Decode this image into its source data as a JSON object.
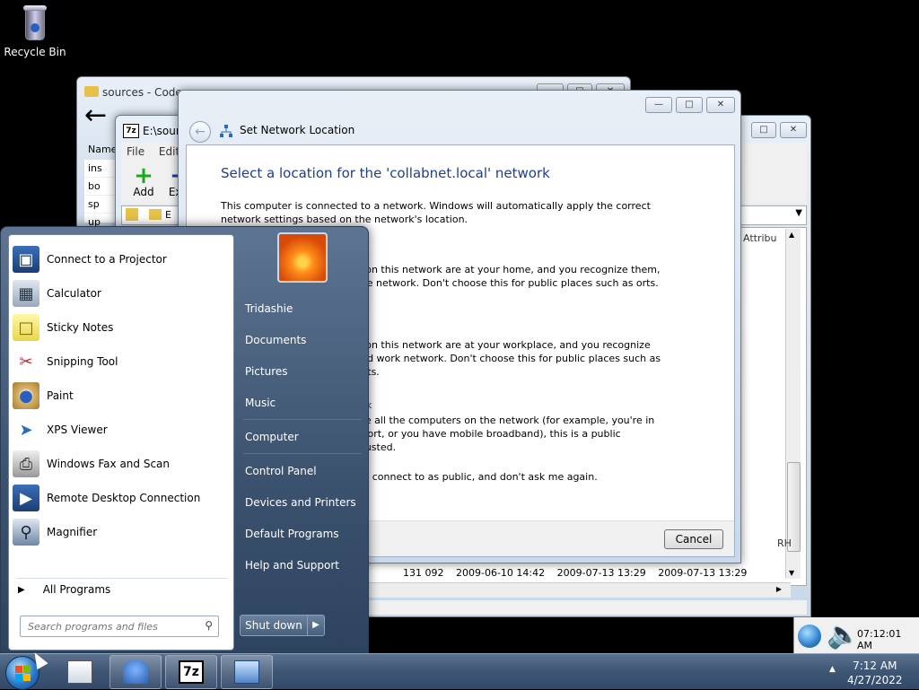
{
  "desktop": {
    "recycle_bin_label": "Recycle Bin"
  },
  "explorer": {
    "title": "sources - Code…",
    "column_name": "Name",
    "rows": [
      "ins",
      "bo",
      "sp",
      "up"
    ]
  },
  "sevenzip": {
    "title": "E:\\sourc",
    "menu": [
      "File",
      "Edit"
    ],
    "toolbar_add": "Add",
    "toolbar_extract": "Extr",
    "address_text": "E",
    "column_attrib": "Attribu",
    "row": {
      "size": "131 092",
      "date1": "2009-06-10 14:42",
      "date2": "2009-07-13 13:29",
      "date3": "2009-07-13 13:29"
    },
    "rh": "RH"
  },
  "netdlg": {
    "title": "Set Network Location",
    "heading": "Select a location for the 'collabnet.local' network",
    "intro": "This computer is connected to a network. Windows will automatically apply the correct network settings based on the network's location.",
    "home_frag": "k",
    "home_text": "s on this network are at your home, and you recognize them, me network.  Don't choose this for public places such as orts.",
    "work_text": "s on this network are at your workplace, and you recognize ted work network.  Don't choose this for public places such as orts.",
    "public_frag": "k",
    "public_text": "ize all the computers on the network (for example, you're in rport, or you have mobile broadband), this is a public trusted.",
    "checkbox_text": "I connect to as public, and don't ask me again.",
    "cancel_label": "Cancel"
  },
  "start_menu": {
    "programs": [
      {
        "label": "Connect to a Projector",
        "icon": "projector-icon"
      },
      {
        "label": "Calculator",
        "icon": "calculator-icon"
      },
      {
        "label": "Sticky Notes",
        "icon": "sticky-notes-icon"
      },
      {
        "label": "Snipping Tool",
        "icon": "scissors-icon"
      },
      {
        "label": "Paint",
        "icon": "paint-palette-icon"
      },
      {
        "label": "XPS Viewer",
        "icon": "xps-icon"
      },
      {
        "label": "Windows Fax and Scan",
        "icon": "fax-icon"
      },
      {
        "label": "Remote Desktop Connection",
        "icon": "remote-desktop-icon"
      },
      {
        "label": "Magnifier",
        "icon": "magnifier-icon"
      }
    ],
    "all_programs": "All Programs",
    "search_placeholder": "Search programs and files",
    "right_links": {
      "user": "Tridashie",
      "documents": "Documents",
      "pictures": "Pictures",
      "music": "Music",
      "computer": "Computer",
      "control_panel": "Control Panel",
      "devices": "Devices and Printers",
      "defaults": "Default Programs",
      "help": "Help and Support"
    },
    "shutdown": "Shut down"
  },
  "notification": {
    "time": "07:12:01 AM"
  },
  "taskbar": {
    "clock_time": "7:12 AM",
    "clock_date": "4/27/2022",
    "apps": [
      "window-app-icon",
      "mascot-app-icon",
      "7zip-icon",
      "control-panel-icon"
    ]
  }
}
